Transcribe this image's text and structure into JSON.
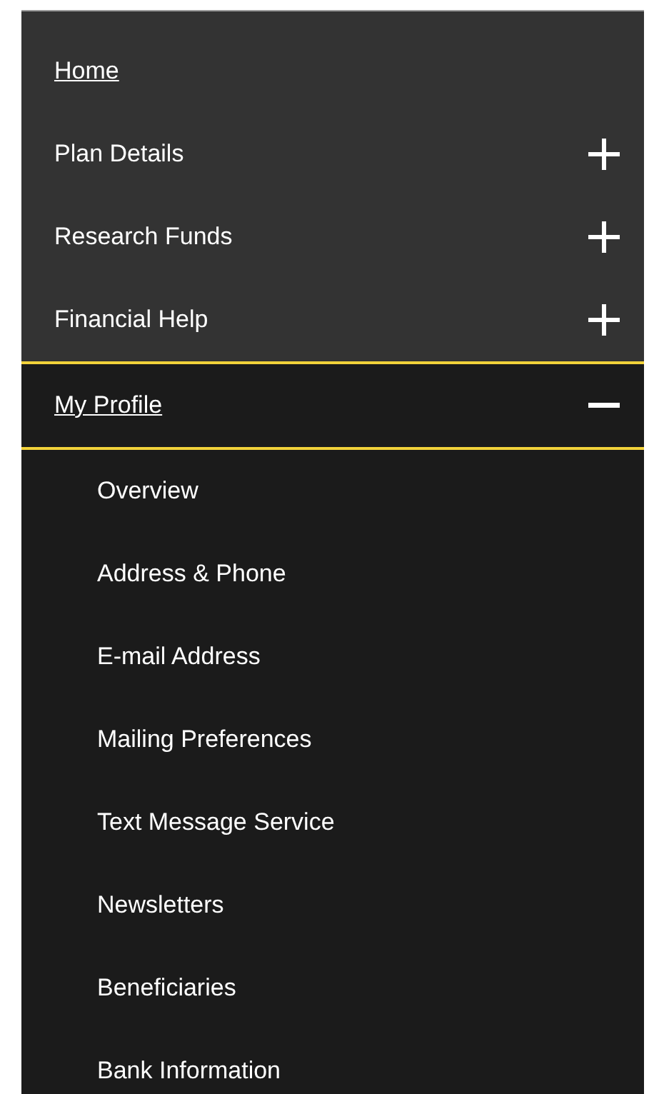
{
  "nav": {
    "items": [
      {
        "label": "Home",
        "kind": "link"
      },
      {
        "label": "Plan Details",
        "kind": "section",
        "expanded": false
      },
      {
        "label": "Research Funds",
        "kind": "section",
        "expanded": false
      },
      {
        "label": "Financial Help",
        "kind": "section",
        "expanded": false
      },
      {
        "label": "My Profile",
        "kind": "section",
        "expanded": true,
        "children": [
          {
            "label": "Overview"
          },
          {
            "label": "Address & Phone"
          },
          {
            "label": "E-mail Address"
          },
          {
            "label": "Mailing Preferences"
          },
          {
            "label": "Text Message Service"
          },
          {
            "label": "Newsletters"
          },
          {
            "label": "Beneficiaries"
          },
          {
            "label": "Bank Information"
          }
        ]
      }
    ]
  }
}
